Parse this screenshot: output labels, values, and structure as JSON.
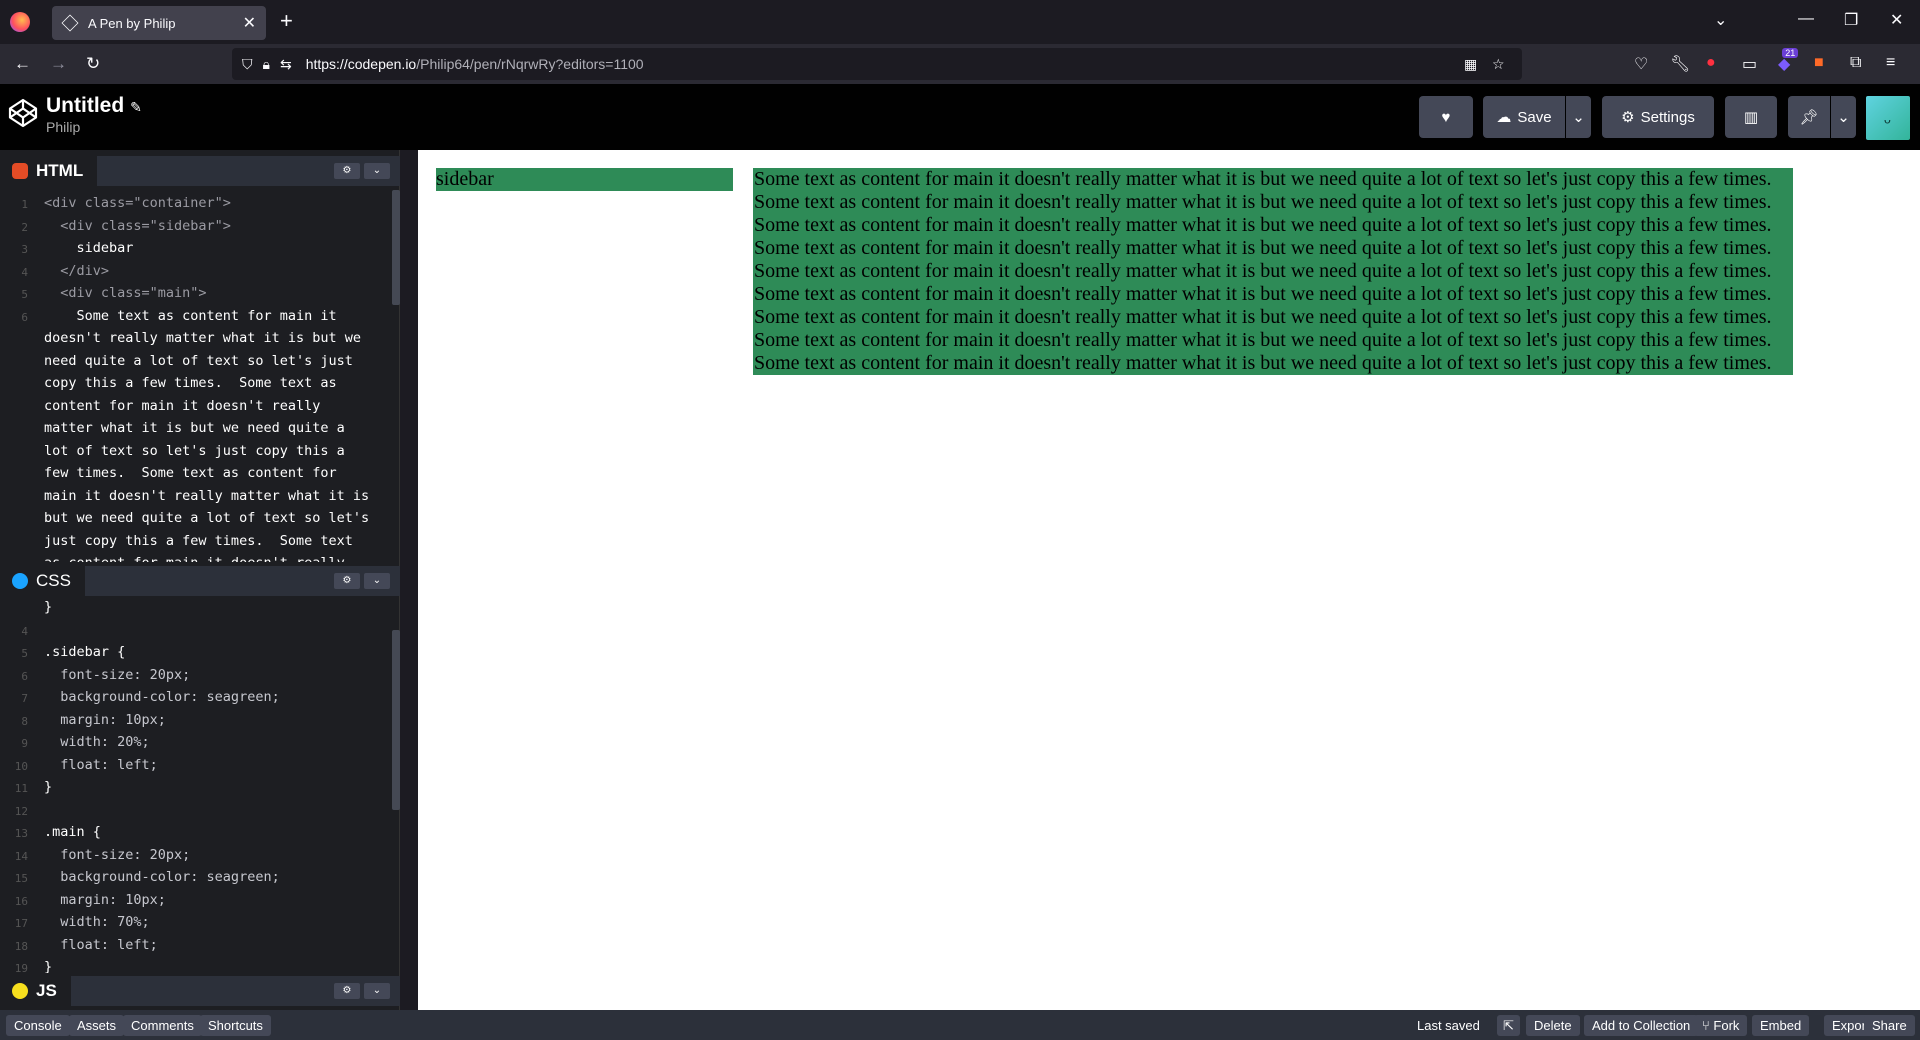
{
  "browser": {
    "tab_title": "A Pen by Philip",
    "url_host": "https://codepen.io",
    "url_path": "/Philip64/pen/rNqrwRy?editors=1100",
    "extension_badge": "21"
  },
  "header": {
    "pen_title": "Untitled",
    "owner": "Philip",
    "save_label": "Save",
    "settings_label": "Settings"
  },
  "editors": {
    "html": {
      "label": "HTML",
      "lines": [
        {
          "n": "1",
          "text": "<div class=\"container\">"
        },
        {
          "n": "2",
          "text": "  <div class=\"sidebar\">"
        },
        {
          "n": "3",
          "text": "    sidebar"
        },
        {
          "n": "4",
          "text": "  </div>"
        },
        {
          "n": "5",
          "text": "  <div class=\"main\">"
        },
        {
          "n": "6",
          "text": "    Some text as content for main it"
        },
        {
          "n": "",
          "text": "doesn't really matter what it is but we"
        },
        {
          "n": "",
          "text": "need quite a lot of text so let's just"
        },
        {
          "n": "",
          "text": "copy this a few times.  Some text as"
        },
        {
          "n": "",
          "text": "content for main it doesn't really"
        },
        {
          "n": "",
          "text": "matter what it is but we need quite a"
        },
        {
          "n": "",
          "text": "lot of text so let's just copy this a"
        },
        {
          "n": "",
          "text": "few times.  Some text as content for"
        },
        {
          "n": "",
          "text": "main it doesn't really matter what it is"
        },
        {
          "n": "",
          "text": "but we need quite a lot of text so let's"
        },
        {
          "n": "",
          "text": "just copy this a few times.  Some text"
        },
        {
          "n": "",
          "text": "as content for main it doesn't really"
        }
      ]
    },
    "css": {
      "label": "CSS",
      "lines": [
        {
          "n": "",
          "text": "}"
        },
        {
          "n": "4",
          "text": ""
        },
        {
          "n": "5",
          "text": ".sidebar {"
        },
        {
          "n": "6",
          "text": "  font-size: 20px;"
        },
        {
          "n": "7",
          "text": "  background-color: seagreen;"
        },
        {
          "n": "8",
          "text": "  margin: 10px;"
        },
        {
          "n": "9",
          "text": "  width: 20%;"
        },
        {
          "n": "10",
          "text": "  float: left;"
        },
        {
          "n": "11",
          "text": "}"
        },
        {
          "n": "12",
          "text": ""
        },
        {
          "n": "13",
          "text": ".main {"
        },
        {
          "n": "14",
          "text": "  font-size: 20px;"
        },
        {
          "n": "15",
          "text": "  background-color: seagreen;"
        },
        {
          "n": "16",
          "text": "  margin: 10px;"
        },
        {
          "n": "17",
          "text": "  width: 70%;"
        },
        {
          "n": "18",
          "text": "  float: left;"
        },
        {
          "n": "19",
          "text": "}"
        }
      ]
    },
    "js": {
      "label": "JS"
    }
  },
  "preview": {
    "sidebar_text": "sidebar",
    "main_lines": [
      "Some text as content for main it doesn't really matter what it is but we need quite a lot of text so let's just copy this a few times.",
      "Some text as content for main it doesn't really matter what it is but we need quite a lot of text so let's just copy this a few times.",
      "Some text as content for main it doesn't really matter what it is but we need quite a lot of text so let's just copy this a few times.",
      "Some text as content for main it doesn't really matter what it is but we need quite a lot of text so let's just copy this a few times.",
      "Some text as content for main it doesn't really matter what it is but we need quite a lot of text so let's just copy this a few times.",
      "Some text as content for main it doesn't really matter what it is but we need quite a lot of text so let's just copy this a few times.",
      "Some text as content for main it doesn't really matter what it is but we need quite a lot of text so let's just copy this a few times.",
      "Some text as content for main it doesn't really matter what it is but we need quite a lot of text so let's just copy this a few times.",
      "Some text as content for main it doesn't really matter what it is but we need quite a lot of text so let's just copy this a few times."
    ]
  },
  "footer": {
    "console": "Console",
    "assets": "Assets",
    "comments": "Comments",
    "shortcuts": "Shortcuts",
    "last_saved": "Last saved",
    "delete": "Delete",
    "add_to_collection": "Add to Collection",
    "fork": "Fork",
    "embed": "Embed",
    "export": "Export",
    "share": "Share"
  },
  "colors": {
    "seagreen": "#2e8b57",
    "html_icon": "#e34c26",
    "css_icon": "#1aa3ff",
    "js_icon": "#f7df1e"
  }
}
